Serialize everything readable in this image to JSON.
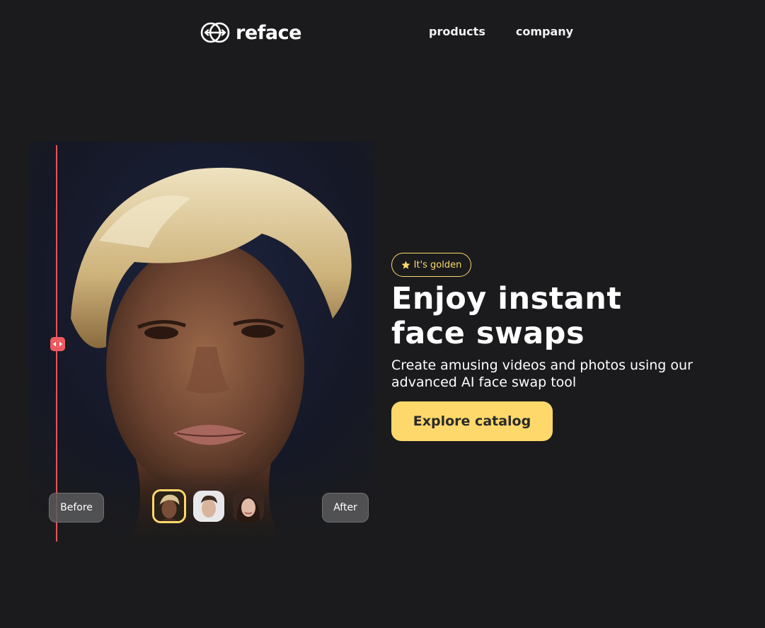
{
  "header": {
    "logo_text": "reface",
    "nav": [
      {
        "label": "products"
      },
      {
        "label": "company"
      }
    ]
  },
  "compare": {
    "before_label": "Before",
    "after_label": "After",
    "thumbnails": [
      {
        "name": "woman-blonde-pixie",
        "selected": true
      },
      {
        "name": "man-dark-hair",
        "selected": false
      },
      {
        "name": "woman-dark-hair",
        "selected": false
      }
    ],
    "divider_color": "#e8545a"
  },
  "hero": {
    "badge_label": "It's golden",
    "headline_line1": "Enjoy instant",
    "headline_line2": "face swaps",
    "subtext_line1": "Create amusing videos and photos using our",
    "subtext_line2": "advanced AI face swap tool",
    "cta_label": "Explore catalog"
  },
  "colors": {
    "background": "#1b1b1d",
    "accent": "#ffd86b",
    "divider": "#e8545a"
  },
  "icons": [
    "reface-logo-icon",
    "star-icon",
    "arrows-horizontal-icon"
  ]
}
